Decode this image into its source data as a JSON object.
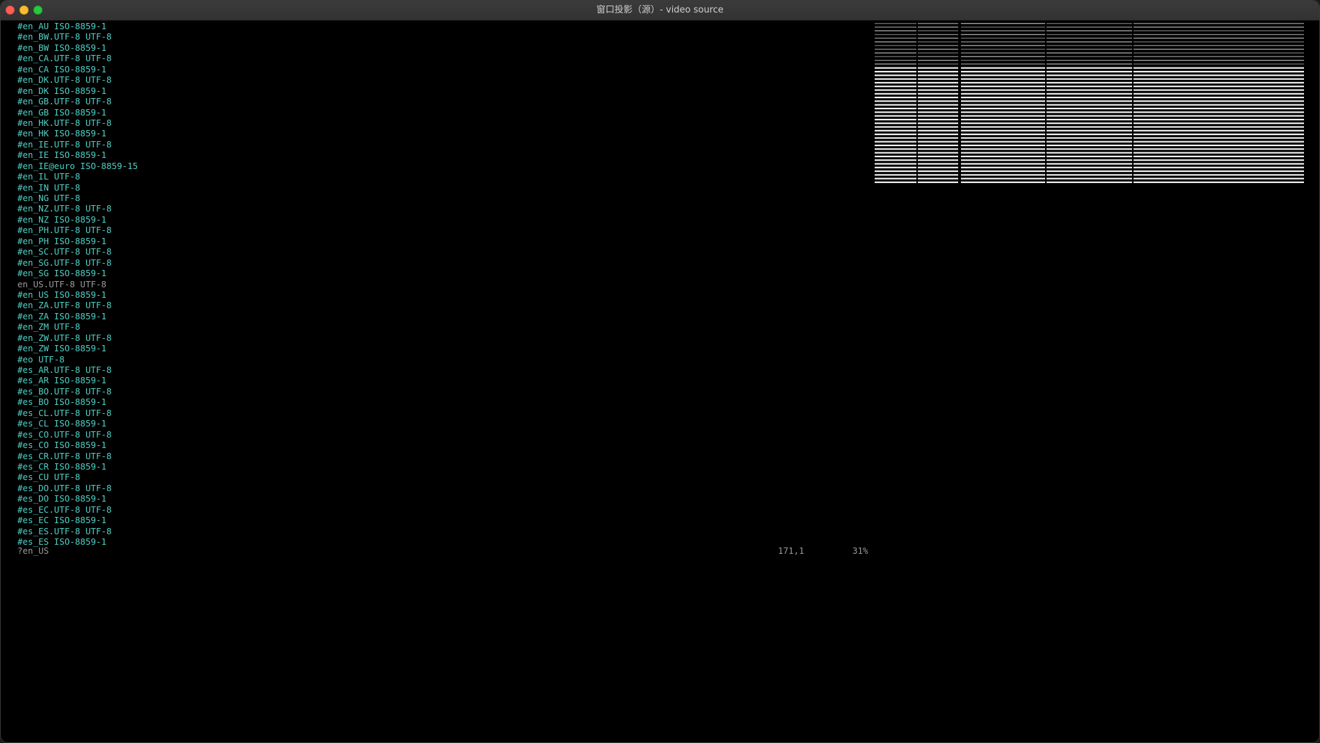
{
  "window": {
    "title": "窗口投影（源）- video source"
  },
  "terminal": {
    "lines": [
      {
        "text": "#en_AU ISO-8859-1",
        "commented": true
      },
      {
        "text": "#en_BW.UTF-8 UTF-8",
        "commented": true
      },
      {
        "text": "#en_BW ISO-8859-1",
        "commented": true
      },
      {
        "text": "#en_CA.UTF-8 UTF-8",
        "commented": true
      },
      {
        "text": "#en_CA ISO-8859-1",
        "commented": true
      },
      {
        "text": "#en_DK.UTF-8 UTF-8",
        "commented": true
      },
      {
        "text": "#en_DK ISO-8859-1",
        "commented": true
      },
      {
        "text": "#en_GB.UTF-8 UTF-8",
        "commented": true
      },
      {
        "text": "#en_GB ISO-8859-1",
        "commented": true
      },
      {
        "text": "#en_HK.UTF-8 UTF-8",
        "commented": true
      },
      {
        "text": "#en_HK ISO-8859-1",
        "commented": true
      },
      {
        "text": "#en_IE.UTF-8 UTF-8",
        "commented": true
      },
      {
        "text": "#en_IE ISO-8859-1",
        "commented": true
      },
      {
        "text": "#en_IE@euro ISO-8859-15",
        "commented": true
      },
      {
        "text": "#en_IL UTF-8",
        "commented": true
      },
      {
        "text": "#en_IN UTF-8",
        "commented": true
      },
      {
        "text": "#en_NG UTF-8",
        "commented": true
      },
      {
        "text": "#en_NZ.UTF-8 UTF-8",
        "commented": true
      },
      {
        "text": "#en_NZ ISO-8859-1",
        "commented": true
      },
      {
        "text": "#en_PH.UTF-8 UTF-8",
        "commented": true
      },
      {
        "text": "#en_PH ISO-8859-1",
        "commented": true
      },
      {
        "text": "#en_SC.UTF-8 UTF-8",
        "commented": true
      },
      {
        "text": "#en_SG.UTF-8 UTF-8",
        "commented": true
      },
      {
        "text": "#en_SG ISO-8859-1",
        "commented": true
      },
      {
        "text": "en_US.UTF-8 UTF-8",
        "commented": false
      },
      {
        "text": "#en_US ISO-8859-1",
        "commented": true
      },
      {
        "text": "#en_ZA.UTF-8 UTF-8",
        "commented": true
      },
      {
        "text": "#en_ZA ISO-8859-1",
        "commented": true
      },
      {
        "text": "#en_ZM UTF-8",
        "commented": true
      },
      {
        "text": "#en_ZW.UTF-8 UTF-8",
        "commented": true
      },
      {
        "text": "#en_ZW ISO-8859-1",
        "commented": true
      },
      {
        "text": "#eo UTF-8",
        "commented": true
      },
      {
        "text": "#es_AR.UTF-8 UTF-8",
        "commented": true
      },
      {
        "text": "#es_AR ISO-8859-1",
        "commented": true
      },
      {
        "text": "#es_BO.UTF-8 UTF-8",
        "commented": true
      },
      {
        "text": "#es_BO ISO-8859-1",
        "commented": true
      },
      {
        "text": "#es_CL.UTF-8 UTF-8",
        "commented": true
      },
      {
        "text": "#es_CL ISO-8859-1",
        "commented": true
      },
      {
        "text": "#es_CO.UTF-8 UTF-8",
        "commented": true
      },
      {
        "text": "#es_CO ISO-8859-1",
        "commented": true
      },
      {
        "text": "#es_CR.UTF-8 UTF-8",
        "commented": true
      },
      {
        "text": "#es_CR ISO-8859-1",
        "commented": true
      },
      {
        "text": "#es_CU UTF-8",
        "commented": true
      },
      {
        "text": "#es_DO.UTF-8 UTF-8",
        "commented": true
      },
      {
        "text": "#es_DO ISO-8859-1",
        "commented": true
      },
      {
        "text": "#es_EC.UTF-8 UTF-8",
        "commented": true
      },
      {
        "text": "#es_EC ISO-8859-1",
        "commented": true
      },
      {
        "text": "#es_ES.UTF-8 UTF-8",
        "commented": true
      },
      {
        "text": "#es_ES ISO-8859-1",
        "commented": true
      }
    ]
  },
  "status": {
    "command": "?en_US",
    "position": "171,1",
    "percent": "31%"
  },
  "colors": {
    "background": "#000000",
    "commented_text": "#4fd1c5",
    "plain_text": "#9a9a9a",
    "titlebar": "#363636"
  }
}
